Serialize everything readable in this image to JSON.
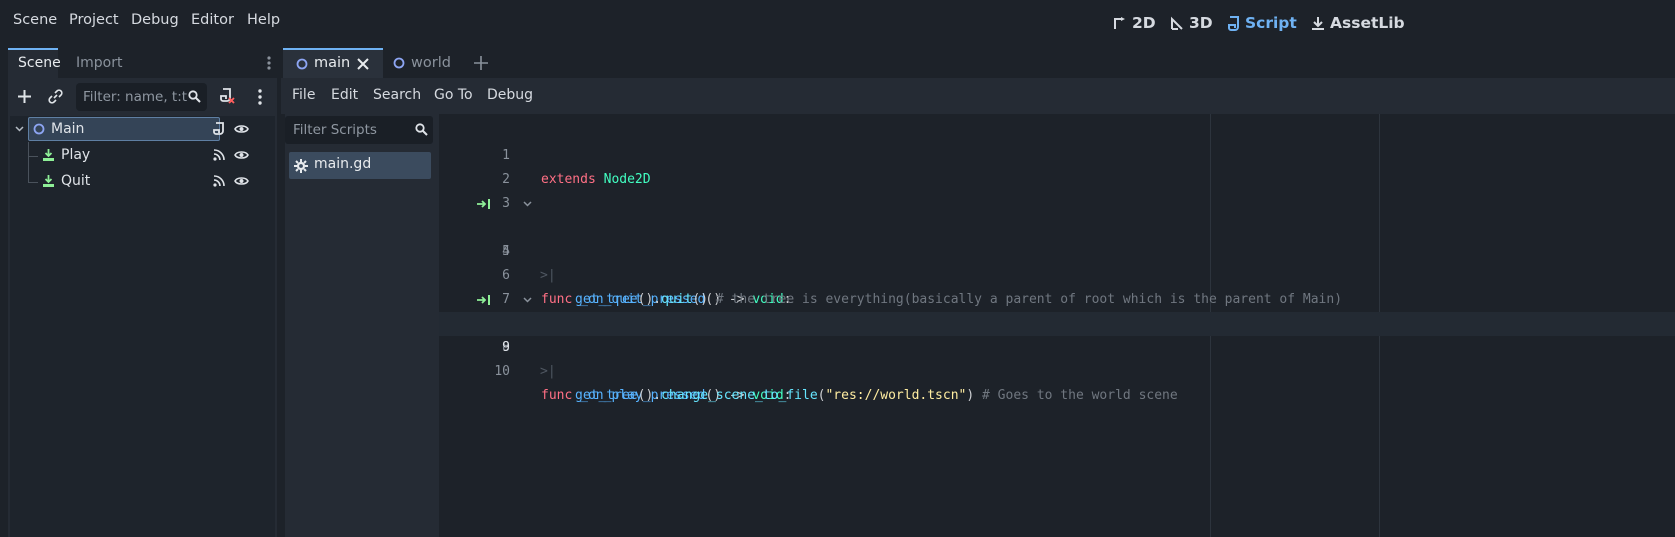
{
  "menu": [
    "Scene",
    "Project",
    "Debug",
    "Editor",
    "Help"
  ],
  "modes": {
    "m2d": "2D",
    "m3d": "3D",
    "script": "Script",
    "assetlib": "AssetLib"
  },
  "dock": {
    "tabs": {
      "scene": "Scene",
      "import": "Import"
    },
    "filter_placeholder": "Filter: name, t:t",
    "tree": [
      {
        "label": "Main"
      },
      {
        "label": "Play"
      },
      {
        "label": "Quit"
      }
    ]
  },
  "file_tabs": {
    "main": "main",
    "world": "world"
  },
  "script_menu": [
    "File",
    "Edit",
    "Search",
    "Go To",
    "Debug"
  ],
  "scripts": {
    "filter_placeholder": "Filter Scripts",
    "items": [
      "main.gd"
    ]
  },
  "code": {
    "line_numbers": [
      "1",
      "2",
      "3",
      "4",
      "5",
      "6",
      "7",
      "8",
      "9",
      "10"
    ],
    "l1": {
      "kw": "extends",
      "type": "Node2D"
    },
    "l4": {
      "kw": "func",
      "name": "_on_quit_pressed",
      "sig": "() -> ",
      "ret": "void",
      "colon": ":"
    },
    "l5": {
      "call1": "get_tree",
      "p1": "().",
      "call2": "quit",
      "p2": "()",
      "comment": " # the tree is everything(basically a parent of root which is the parent of Main)"
    },
    "l8": {
      "kw": "func",
      "name": "_on_play_pressed",
      "sig": "() -> ",
      "ret": "void",
      "colon": ":"
    },
    "l9": {
      "call1": "get_tree",
      "p1": "().",
      "call2": "change_scene_to_file",
      "p2": "(",
      "str": "\"res://world.tscn\"",
      "p3": ")",
      "comment": " # Goes to the world scene"
    }
  },
  "colors": {
    "accent": "#6fb2f3",
    "keyword": "#ff7085",
    "type": "#42ffc2",
    "function": "#57b3ff",
    "string": "#ffeda1",
    "comment": "#707780",
    "node_green": "#8eef97"
  }
}
